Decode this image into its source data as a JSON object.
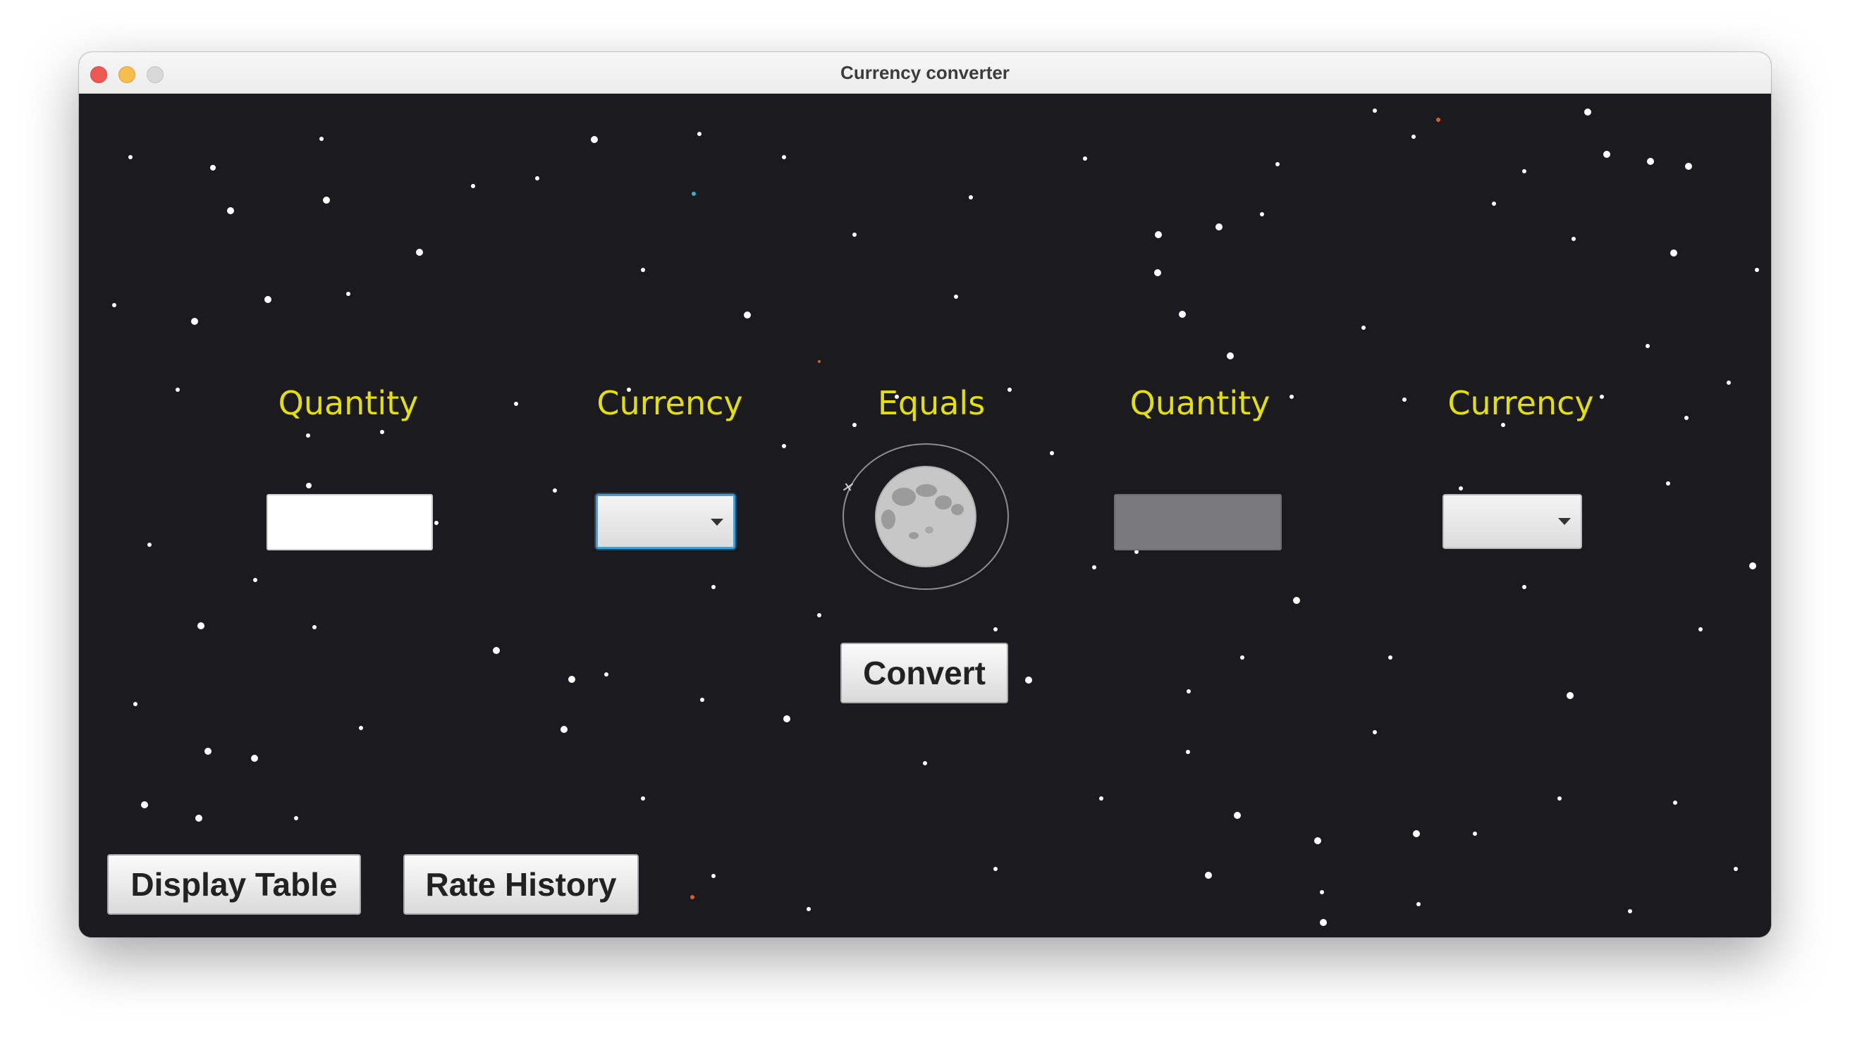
{
  "window": {
    "title": "Currency converter"
  },
  "labels": {
    "from_quantity": "Quantity",
    "from_currency": "Currency",
    "equals": "Equals",
    "to_quantity": "Quantity",
    "to_currency": "Currency"
  },
  "inputs": {
    "from_quantity_value": "",
    "to_quantity_value": "",
    "from_currency_selected": "",
    "to_currency_selected": ""
  },
  "buttons": {
    "convert": "Convert",
    "display_table": "Display Table",
    "rate_history": "Rate History"
  },
  "icons": {
    "center": "moon-icon",
    "dropdown": "chevron-down-icon"
  },
  "colors": {
    "background": "#1b1a1f",
    "label": "#e5e000",
    "focus_ring": "#3ea0d8"
  }
}
